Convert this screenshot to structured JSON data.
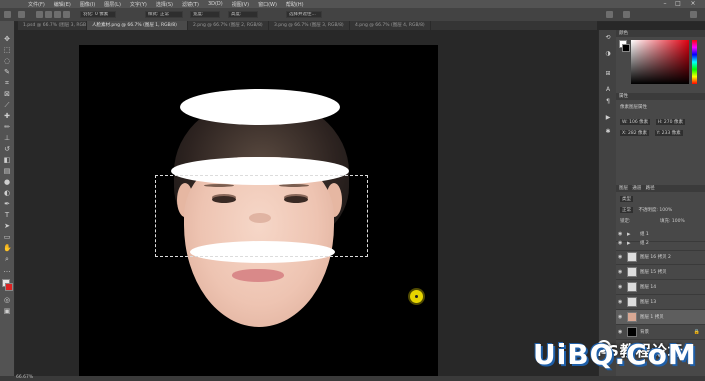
{
  "menubar": {
    "items": [
      "文件(F)",
      "编辑(E)",
      "图像(I)",
      "图层(L)",
      "文字(Y)",
      "选择(S)",
      "滤镜(T)",
      "3D(D)",
      "视图(V)",
      "窗口(W)",
      "帮助(H)"
    ]
  },
  "options": {
    "feather": "羽化: 0 像素",
    "style": "样式: 正常",
    "width": "宽度:",
    "height": "高度:",
    "select_mask": "选择并遮住..."
  },
  "tabs": [
    "1.psd @ 66.7% (图层 3, RGB/8)",
    "人脸素材.png @ 66.7% (图层 1, RGB/8)",
    "2.png @ 66.7% (图层 2, RGB/8)",
    "3.png @ 66.7% (图层 3, RGB/8)",
    "4.png @ 66.7% (图层 4, RGB/8)"
  ],
  "panels": {
    "color_tab": "颜色",
    "properties_tab": "属性",
    "properties_title": "像素图层属性",
    "w": "W: 106 像素",
    "h": "H: 270 像素",
    "x": "X: 282 像素",
    "y": "Y: 233 像素",
    "layers_tab": "图层",
    "channels_tab": "通道",
    "paths_tab": "路径",
    "kind": "类型",
    "mode": "正常",
    "opacity": "不透明度: 100%",
    "lock": "锁定:",
    "fill": "填充: 100%"
  },
  "layers": [
    {
      "name": "组 1",
      "type": "folder",
      "selected": false
    },
    {
      "name": "组 2",
      "type": "folder",
      "selected": false
    },
    {
      "name": "图层 16 拷贝 2",
      "type": "pixel",
      "selected": false
    },
    {
      "name": "图层 15 拷贝",
      "type": "pixel",
      "selected": false
    },
    {
      "name": "图层 14",
      "type": "pixel",
      "selected": false
    },
    {
      "name": "图层 13",
      "type": "pixel",
      "selected": false
    },
    {
      "name": "图层 1 拷贝",
      "type": "pixel",
      "selected": true
    },
    {
      "name": "背景",
      "type": "background",
      "selected": false
    }
  ],
  "status": {
    "zoom": "66.67%"
  },
  "watermark": {
    "site": "UiBQ.CoM",
    "brand": "PS教程论坛"
  },
  "colors": {
    "selection_dot": "#e6d500",
    "accent_red": "#e00010"
  }
}
